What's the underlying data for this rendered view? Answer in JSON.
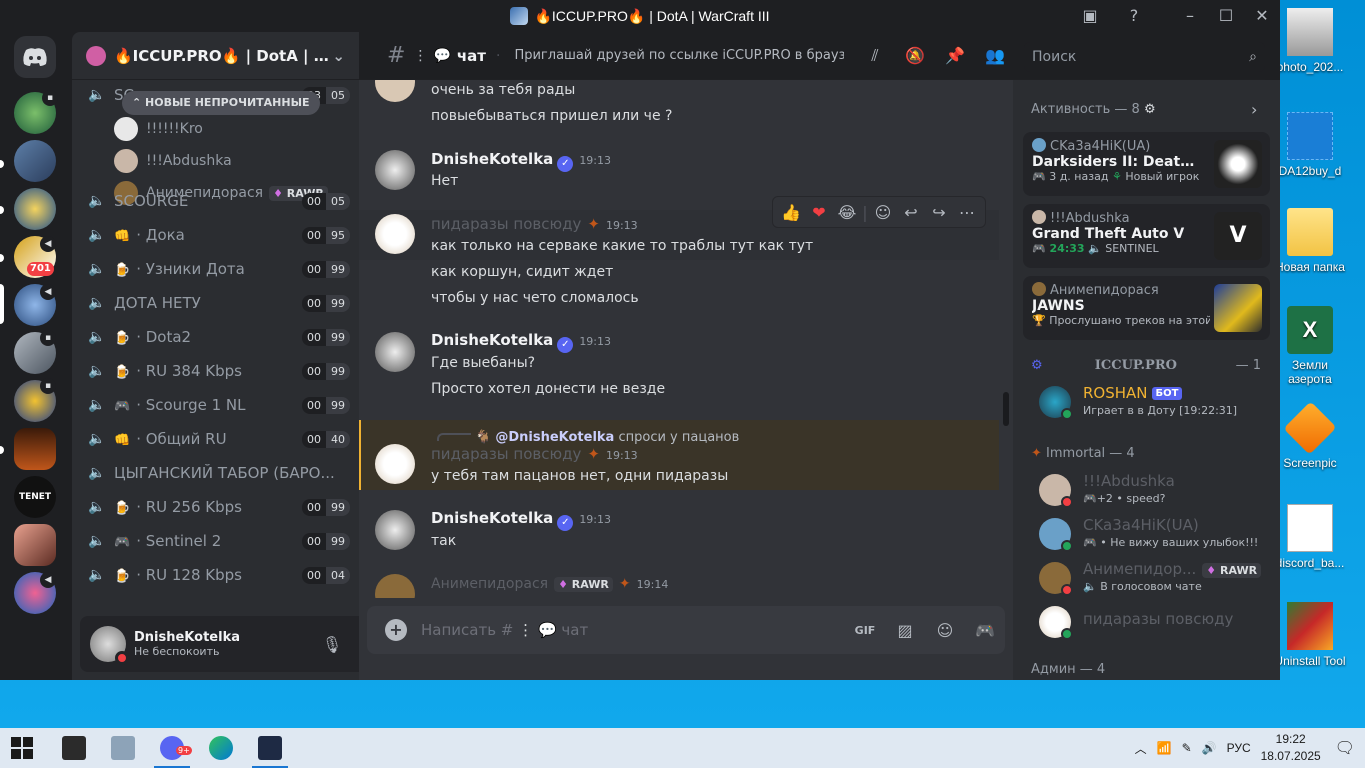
{
  "window": {
    "title": "🔥ICCUP.PRO🔥 | DotA | WarCraft III"
  },
  "rail": {
    "mention_count": "701"
  },
  "sidebar": {
    "server_name": "🔥ICCUP.PRO🔥 | DotA | Wa...",
    "new_unread_label": "НОВЫЕ НЕПРОЧИТАННЫЕ",
    "partial_channel": {
      "name": "SC",
      "count_a": "03",
      "count_b": "05"
    },
    "voice_users": [
      {
        "name": "!!!!!!Kro",
        "tag": ""
      },
      {
        "name": "!!!Abdushka",
        "tag": ""
      },
      {
        "name": "Анимепидорася",
        "tag": "RAWR"
      }
    ],
    "channels": [
      {
        "emoji": "",
        "name": "SCOURGE",
        "count_a": "00",
        "count_b": "05"
      },
      {
        "emoji": "👊",
        "name": "· Дока",
        "count_a": "00",
        "count_b": "95"
      },
      {
        "emoji": "🍺",
        "name": "· Узники Дота",
        "count_a": "00",
        "count_b": "99"
      },
      {
        "emoji": "",
        "name": "ДОТА НЕТУ",
        "count_a": "00",
        "count_b": "99"
      },
      {
        "emoji": "🍺",
        "name": "· Dota2",
        "count_a": "00",
        "count_b": "99"
      },
      {
        "emoji": "🍺",
        "name": "· RU 384 Kbps",
        "count_a": "00",
        "count_b": "99"
      },
      {
        "emoji": "🎮",
        "name": "· Scourge 1 NL",
        "count_a": "00",
        "count_b": "99"
      },
      {
        "emoji": "👊",
        "name": "· Общий RU",
        "count_a": "00",
        "count_b": "40"
      },
      {
        "emoji": "",
        "name": "ЦЫГАНСКИЙ ТАБОР (БАРО...",
        "count_a": "",
        "count_b": ""
      },
      {
        "emoji": "🍺",
        "name": "· RU 256 Kbps",
        "count_a": "00",
        "count_b": "99"
      },
      {
        "emoji": "🎮",
        "name": "· Sentinel 2",
        "count_a": "00",
        "count_b": "99"
      },
      {
        "emoji": "🍺",
        "name": "· RU 128 Kbps",
        "count_a": "00",
        "count_b": "04"
      }
    ]
  },
  "user_panel": {
    "username": "DnisheKotelka",
    "status": "Не беспокоить"
  },
  "chat_header": {
    "channel": "чат",
    "topic": "Приглашай друзей по ссылке iCCUP.PRO в браузер...",
    "search_placeholder": "Поиск"
  },
  "messages": {
    "m0_line1": "очень за тебя рады",
    "m0_line2": "повыебываться пришел или че ?",
    "m1_author": "DnisheKotelka",
    "m1_time": "19:13",
    "m1_text": "Нет",
    "m2_author": "пидаразы повсюду",
    "m2_time": "19:13",
    "m2_line1": "как только на серваке какие то траблы тут как тут",
    "m2_line2": "как коршун, сидит ждет",
    "m2_line3": "чтобы у нас чето сломалось",
    "m3_author": "DnisheKotelka",
    "m3_time": "19:13",
    "m3_line1": "Где выебаны?",
    "m3_line2": "Просто хотел донести не везде",
    "reply_to": "@DnisheKotelka",
    "reply_text": "спроси у пацанов",
    "m4_author": "пидаразы повсюду",
    "m4_time": "19:13",
    "m4_text": "у тебя там пацанов нет, одни пидаразы",
    "m5_author": "DnisheKotelka",
    "m5_time": "19:13",
    "m5_text": "так",
    "m6_author": "Анимепидорася",
    "m6_tag": "RAWR",
    "m6_time": "19:14"
  },
  "composer": {
    "placeholder": "Написать #",
    "channel": "чат"
  },
  "members": {
    "activity_title": "Активность — 8",
    "activities": [
      {
        "user": "CKa3a4HiK(UA)",
        "game": "Darksiders II: Deathinitive ...",
        "meta_a": "3 д. назад",
        "meta_b": "Новый игрок"
      },
      {
        "user": "!!!Abdushka",
        "game": "Grand Theft Auto V",
        "meta_a": "24:33",
        "meta_b": "SENTINEL"
      },
      {
        "user": "Анимепидорася",
        "game": "JAWNS",
        "meta_a": "",
        "meta_b": "Прослушано треков на этой..."
      }
    ],
    "role1_title": "ICCUP.PRO",
    "role1_count": "— 1",
    "bot_name": "ROSHAN",
    "bot_tag": "БОТ",
    "bot_status": "Играет в в Доту [19:22:31]",
    "role2_title": "Immortal — 4",
    "immortal": [
      {
        "name": "!!!Abdushka",
        "sub": "+2 • speed?",
        "tag": ""
      },
      {
        "name": "CKa3a4HiK(UA)",
        "sub": "• Не вижу ваших улыбок!!!",
        "tag": ""
      },
      {
        "name": "Анимепидор...",
        "sub": "В голосовом чате",
        "tag": "RAWR"
      },
      {
        "name": "пидаразы повсюду",
        "sub": "",
        "tag": ""
      }
    ],
    "role3_title": "Админ — 4"
  },
  "desktop_icons": [
    {
      "label": "photo_202..."
    },
    {
      "label": "DA12buy_d"
    },
    {
      "label": "Новая папка"
    },
    {
      "label": "Земли азерота"
    },
    {
      "label": "Screenpic"
    },
    {
      "label": "discord_ba..."
    },
    {
      "label": "Uninstall Tool"
    }
  ],
  "taskbar": {
    "lang": "РУС",
    "time": "19:22",
    "date": "18.07.2025",
    "notif": "9+"
  },
  "colors": {
    "accent": "#5865f2",
    "online": "#23a55a",
    "dnd": "#f23f43",
    "bot_gold": "#f0b232"
  }
}
